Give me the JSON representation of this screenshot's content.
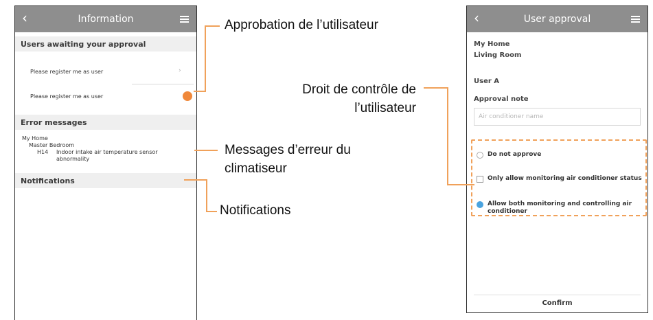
{
  "left_screen": {
    "title": "Information",
    "section_users": "Users awaiting your approval",
    "request_1": "Please register me as user",
    "request_2": "Please register me as user",
    "section_errors": "Error messages",
    "err_home": "My Home",
    "err_room": "Master Bedroom",
    "err_code": "H14",
    "err_text": "Indoor intake air temperature sensor abnormality",
    "section_notifications": "Notifications"
  },
  "right_screen": {
    "title": "User approval",
    "home": "My Home",
    "room": "Living Room",
    "user": "User A",
    "approval_note_label": "Approval note",
    "approval_note_placeholder": "Air conditioner name",
    "options": [
      {
        "label": "Do not approve",
        "selected": false
      },
      {
        "label": "Only allow monitoring air conditioner status",
        "selected": false
      },
      {
        "label": "Allow both monitoring and controlling air conditioner",
        "selected": true
      }
    ],
    "confirm": "Confirm"
  },
  "annotations": {
    "approval": "Approbation de l’utilisateur",
    "control_rights_1": "Droit de contrôle de",
    "control_rights_2": "l’utilisateur",
    "error_messages_1": "Messages d’erreur du",
    "error_messages_2": "climatiseur",
    "notifications": "Notifications"
  },
  "colors": {
    "appbar": "#8e8e8e",
    "accent_orange": "#f0883a",
    "annotation_line": "#f0a15a",
    "radio_selected": "#4aa3df"
  }
}
